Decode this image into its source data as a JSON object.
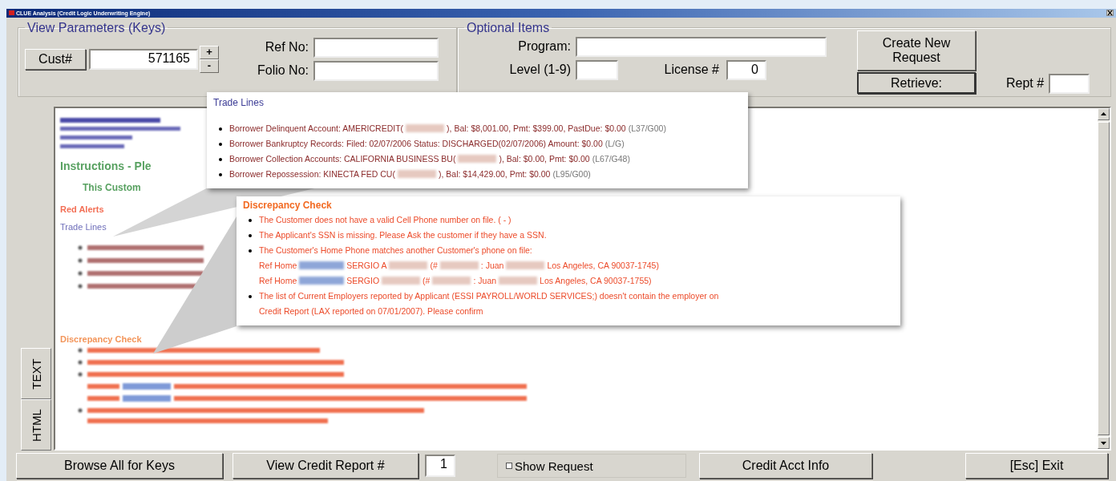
{
  "window": {
    "title": "CLUE Analysis (Credit Logic Underwriting Engine)"
  },
  "view_parameters": {
    "legend": "View Parameters (Keys)",
    "cust_button": "Cust#",
    "cust_value": "571165",
    "spin_up": "+",
    "spin_down": "-",
    "ref_label": "Ref No:",
    "folio_label": "Folio No:"
  },
  "optional_items": {
    "legend": "Optional Items",
    "program_label": "Program:",
    "level_label": "Level (1-9)",
    "license_label": "License #",
    "license_value": "0",
    "create_button": "Create New Request",
    "retrieve_button": "Retrieve:",
    "rept_label": "Rept #"
  },
  "side_tabs": [
    "TEXT",
    "HTML"
  ],
  "report": {
    "instructions": "Instructions - Ple",
    "instruction_item": "This Custom",
    "red_alerts": "Red Alerts",
    "trade_lines": "Trade Lines",
    "discrepancy": "Discrepancy Check"
  },
  "trade_callout": {
    "title": "Trade Lines",
    "items": [
      {
        "segments": [
          {
            "kind": "text",
            "text": "Borrower Delinquent Account: AMERICREDIT("
          },
          {
            "kind": "redacted"
          },
          {
            "kind": "text",
            "text": "), Bal: $8,001.00, Pmt: $399.00, PastDue: $0.00"
          }
        ],
        "code": "(L37/G00)"
      },
      {
        "segments": [
          {
            "kind": "text",
            "text": "Borrower Bankruptcy Records: Filed: 02/07/2006 Status: DISCHARGED(02/07/2006) Amount: $0.00"
          }
        ],
        "code": "(L/G)"
      },
      {
        "segments": [
          {
            "kind": "text",
            "text": "Borrower Collection Accounts: CALIFORNIA BUSINESS BU("
          },
          {
            "kind": "redacted"
          },
          {
            "kind": "text",
            "text": "), Bal: $0.00, Pmt: $0.00"
          }
        ],
        "code": "(L67/G48)"
      },
      {
        "segments": [
          {
            "kind": "text",
            "text": "Borrower Repossession: KINECTA FED CU("
          },
          {
            "kind": "redacted"
          },
          {
            "kind": "text",
            "text": "), Bal: $14,429.00, Pmt: $0.00"
          }
        ],
        "code": "(L95/G00)"
      }
    ]
  },
  "discrepancy_callout": {
    "title": "Discrepancy Check",
    "items": [
      {
        "lines": [
          [
            {
              "kind": "text",
              "text": "The Customer does not have a valid Cell Phone number on file. ( - )"
            }
          ]
        ]
      },
      {
        "lines": [
          [
            {
              "kind": "text",
              "text": "The Applicant's SSN is missing. Please Ask the customer if they have a SSN."
            }
          ]
        ]
      },
      {
        "lines": [
          [
            {
              "kind": "text",
              "text": "The Customer's Home Phone matches another Customer's phone on file:"
            }
          ],
          [
            {
              "kind": "text",
              "text": "Ref Home"
            },
            {
              "kind": "redacted-link"
            },
            {
              "kind": "text",
              "text": "SERGIO A"
            },
            {
              "kind": "redacted"
            },
            {
              "kind": "text",
              "text": "(#"
            },
            {
              "kind": "redacted"
            },
            {
              "kind": "text",
              "text": ": Juan"
            },
            {
              "kind": "redacted"
            },
            {
              "kind": "text",
              "text": "Los Angeles, CA 90037-1745)"
            }
          ],
          [
            {
              "kind": "text",
              "text": "Ref Home"
            },
            {
              "kind": "redacted-link"
            },
            {
              "kind": "text",
              "text": "SERGIO"
            },
            {
              "kind": "redacted"
            },
            {
              "kind": "text",
              "text": "(#"
            },
            {
              "kind": "redacted"
            },
            {
              "kind": "text",
              "text": ": Juan"
            },
            {
              "kind": "redacted"
            },
            {
              "kind": "text",
              "text": "Los Angeles, CA 90037-1755)"
            }
          ]
        ]
      },
      {
        "lines": [
          [
            {
              "kind": "text",
              "text": "The list of Current Employers reported by Applicant (ESSI PAYROLL/WORLD SERVICES;) doesn't contain the employer on"
            }
          ],
          [
            {
              "kind": "text",
              "text": "Credit Report (LAX reported on 07/01/2007). Please confirm"
            }
          ]
        ]
      }
    ]
  },
  "bottom_bar": {
    "browse": "Browse All for Keys",
    "view_report": "View Credit Report #",
    "report_number": "1",
    "show_request": {
      "label": "Show Request",
      "checked": false
    },
    "credit_info": "Credit Acct Info",
    "exit": "[Esc] Exit"
  }
}
